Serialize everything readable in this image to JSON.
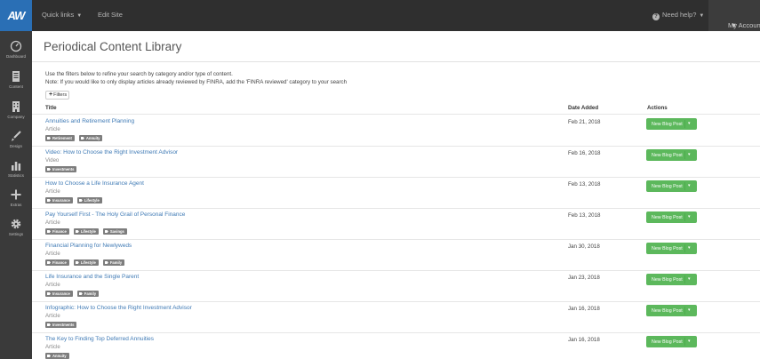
{
  "app": {
    "logo_text": "AW",
    "quick_links": "Quick links",
    "edit_site": "Edit Site",
    "need_help": "Need help?",
    "my_account": "My Account"
  },
  "sidebar": {
    "items": [
      {
        "label": "Dashboard",
        "icon": "dashboard-icon"
      },
      {
        "label": "Content",
        "icon": "content-icon"
      },
      {
        "label": "Company",
        "icon": "company-icon"
      },
      {
        "label": "Design",
        "icon": "design-icon"
      },
      {
        "label": "Statistics",
        "icon": "statistics-icon"
      },
      {
        "label": "Extras",
        "icon": "extras-icon"
      },
      {
        "label": "Settings",
        "icon": "settings-icon"
      }
    ]
  },
  "page": {
    "title": "Periodical Content Library",
    "intro_line1": "Use the filters below to refine your search by category and/or type of content.",
    "intro_line2": "Note: If you would like to only display articles already reviewed by FINRA, add the 'FINRA reviewed' category to your search",
    "filters_label": "Filters"
  },
  "table": {
    "headers": {
      "title": "Title",
      "date": "Date Added",
      "actions": "Actions"
    },
    "action_label": "New Blog Post",
    "rows": [
      {
        "title": "Annuities and Retirement Planning",
        "type": "Article",
        "tags": [
          "Retirement",
          "Annuity"
        ],
        "date": "Feb 21, 2018"
      },
      {
        "title": "Video: How to Choose the Right Investment Advisor",
        "type": "Video",
        "tags": [
          "Investments"
        ],
        "date": "Feb 16, 2018"
      },
      {
        "title": "How to Choose a Life Insurance Agent",
        "type": "Article",
        "tags": [
          "Insurance",
          "Lifestyle"
        ],
        "date": "Feb 13, 2018"
      },
      {
        "title": "Pay Yourself First - The Holy Grail of Personal Finance",
        "type": "Article",
        "tags": [
          "Finance",
          "Lifestyle",
          "Savings"
        ],
        "date": "Feb 13, 2018"
      },
      {
        "title": "Financial Planning for Newlyweds",
        "type": "Article",
        "tags": [
          "Finance",
          "Lifestyle",
          "Family"
        ],
        "date": "Jan 30, 2018"
      },
      {
        "title": "Life Insurance and the Single Parent",
        "type": "Article",
        "tags": [
          "Insurance",
          "Family"
        ],
        "date": "Jan 23, 2018"
      },
      {
        "title": "Infographic: How to Choose the Right Investment Advisor",
        "type": "Article",
        "tags": [
          "Investments"
        ],
        "date": "Jan 16, 2018"
      },
      {
        "title": "The Key to Finding Top Deferred Annuities",
        "type": "Article",
        "tags": [
          "Annuity"
        ],
        "date": "Jan 16, 2018"
      }
    ]
  },
  "colors": {
    "topbar": "#2f2f2f",
    "sidebar": "#3a3a3a",
    "logo": "#2a6fb5",
    "link": "#3f7ab5",
    "button_green": "#5cb85c",
    "tag_gray": "#7d7d7d"
  }
}
